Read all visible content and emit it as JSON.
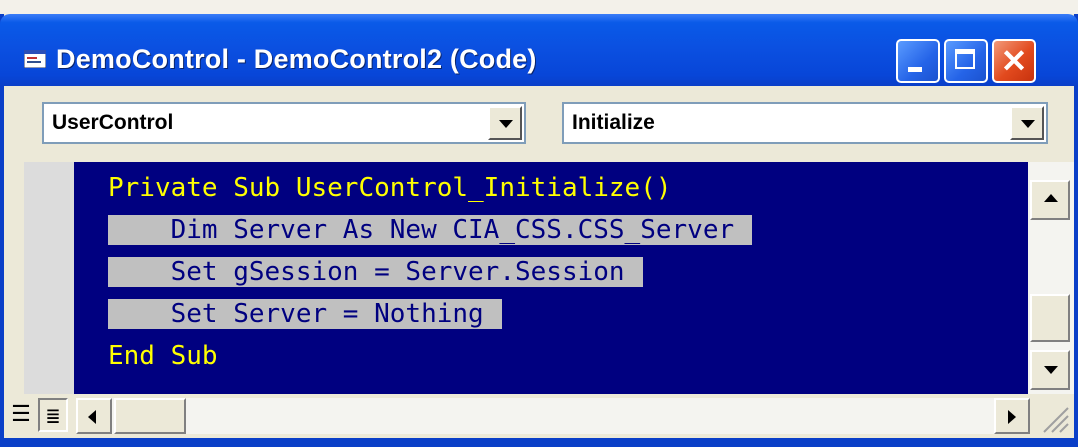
{
  "window": {
    "title": "DemoControl - DemoControl2 (Code)",
    "icon": "code-window-icon",
    "controls": {
      "minimize": "minimize-icon",
      "maximize": "maximize-icon",
      "close": "✕"
    }
  },
  "object_combo": {
    "value": "UserControl"
  },
  "procedure_combo": {
    "value": "Initialize"
  },
  "code": {
    "lines": [
      "Private Sub UserControl_Initialize()",
      "    Dim Server As New CIA_CSS.CSS_Server",
      "    Set gSession = Server.Session",
      "    Set Server = Nothing",
      "End Sub"
    ]
  },
  "colors": {
    "editor_background": "#000080",
    "code_text": "#ffff00",
    "selection_background": "#c0c0c0",
    "titlebar": "#0a5ae8",
    "close_button": "#e24a1e"
  },
  "bottom": {
    "procedure_view_glyph": "☰",
    "full_module_view_glyph": "≣"
  }
}
